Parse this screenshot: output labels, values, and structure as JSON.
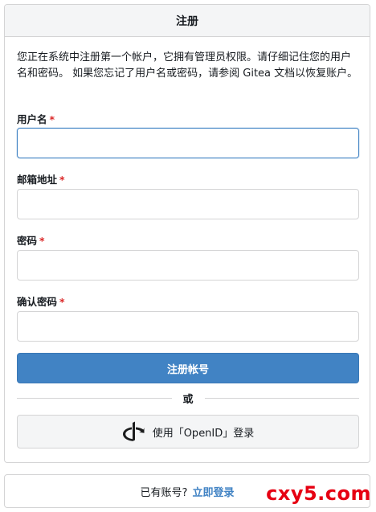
{
  "header": {
    "title": "注册"
  },
  "intro": {
    "text": "您正在系统中注册第一个帐户，它拥有管理员权限。请仔细记住您的用户名和密码。 如果您忘记了用户名或密码，请参阅 Gitea 文档以恢复账户。"
  },
  "form": {
    "username": {
      "label": "用户名",
      "required_mark": "*",
      "value": "",
      "placeholder": ""
    },
    "email": {
      "label": "邮箱地址",
      "required_mark": "*",
      "value": "",
      "placeholder": ""
    },
    "password": {
      "label": "密码",
      "required_mark": "*",
      "value": "",
      "placeholder": ""
    },
    "confirm_password": {
      "label": "确认密码",
      "required_mark": "*",
      "value": "",
      "placeholder": ""
    },
    "submit_label": "注册帐号"
  },
  "divider": {
    "text": "或"
  },
  "openid": {
    "label": "使用「OpenID」登录",
    "icon": "openid-icon"
  },
  "footer": {
    "prompt": "已有账号?",
    "link": "立即登录"
  },
  "watermark": {
    "text": "cxy5.com"
  },
  "colors": {
    "primary": "#4183c4",
    "required": "#db2828",
    "watermark": "#e60012"
  }
}
